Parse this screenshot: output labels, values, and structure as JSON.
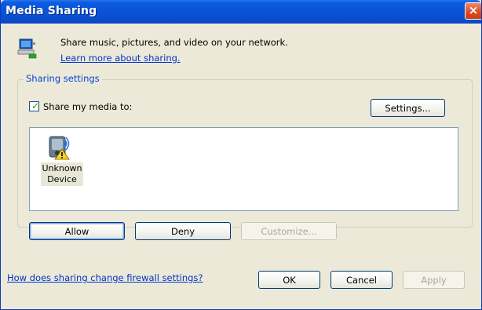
{
  "window": {
    "title": "Media Sharing",
    "close_label": "×"
  },
  "header": {
    "icon": "network-computer-icon",
    "description": "Share music, pictures, and video on your network.",
    "learn_link": "Learn more about sharing."
  },
  "sharing": {
    "group_label": "Sharing settings",
    "share_checkbox_label": "Share my media to:",
    "share_checked": true,
    "settings_button": "Settings...",
    "devices": [
      {
        "name": "Unknown Device",
        "icon": "unknown-device-warning-icon"
      }
    ],
    "allow_button": "Allow",
    "deny_button": "Deny",
    "customize_button": "Customize..."
  },
  "footer": {
    "firewall_link": "How does sharing change firewall settings?",
    "ok_button": "OK",
    "cancel_button": "Cancel",
    "apply_button": "Apply"
  }
}
